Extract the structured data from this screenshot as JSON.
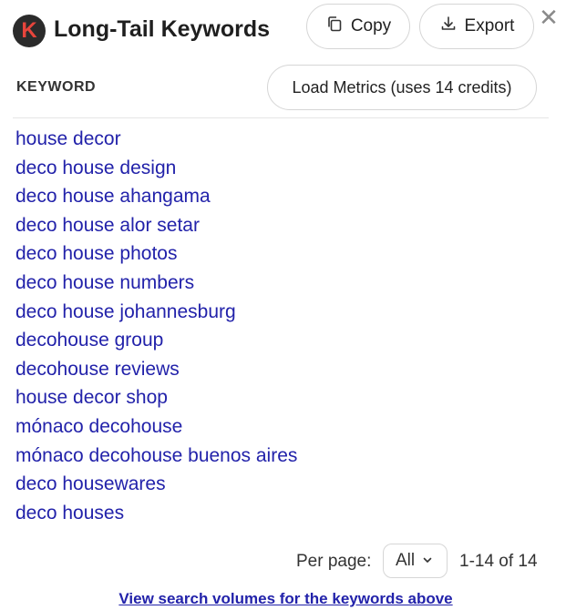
{
  "header": {
    "logo_letter": "K",
    "title": "Long-Tail Keywords",
    "copy_label": "Copy",
    "export_label": "Export",
    "close_glyph": "✕",
    "copy_icon": "copy-icon",
    "export_icon": "download-icon"
  },
  "table": {
    "column_header": "KEYWORD",
    "load_metrics_label": "Load Metrics (uses 14 credits)"
  },
  "keywords": [
    "house decor",
    "deco house design",
    "deco house ahangama",
    "deco house alor setar",
    "deco house photos",
    "deco house numbers",
    "deco house johannesburg",
    "decohouse group",
    "decohouse reviews",
    "house decor shop",
    "mónaco decohouse",
    "mónaco decohouse buenos aires",
    "deco housewares",
    "deco houses"
  ],
  "pagination": {
    "per_page_label": "Per page:",
    "per_page_value": "All",
    "range_text": "1-14 of 14"
  },
  "footer": {
    "link_text": "View search volumes for the keywords above"
  },
  "colors": {
    "link": "#2222aa",
    "logo_bg": "#2b2b2b",
    "logo_letter": "#e8453c",
    "border": "#d6d6d6"
  }
}
